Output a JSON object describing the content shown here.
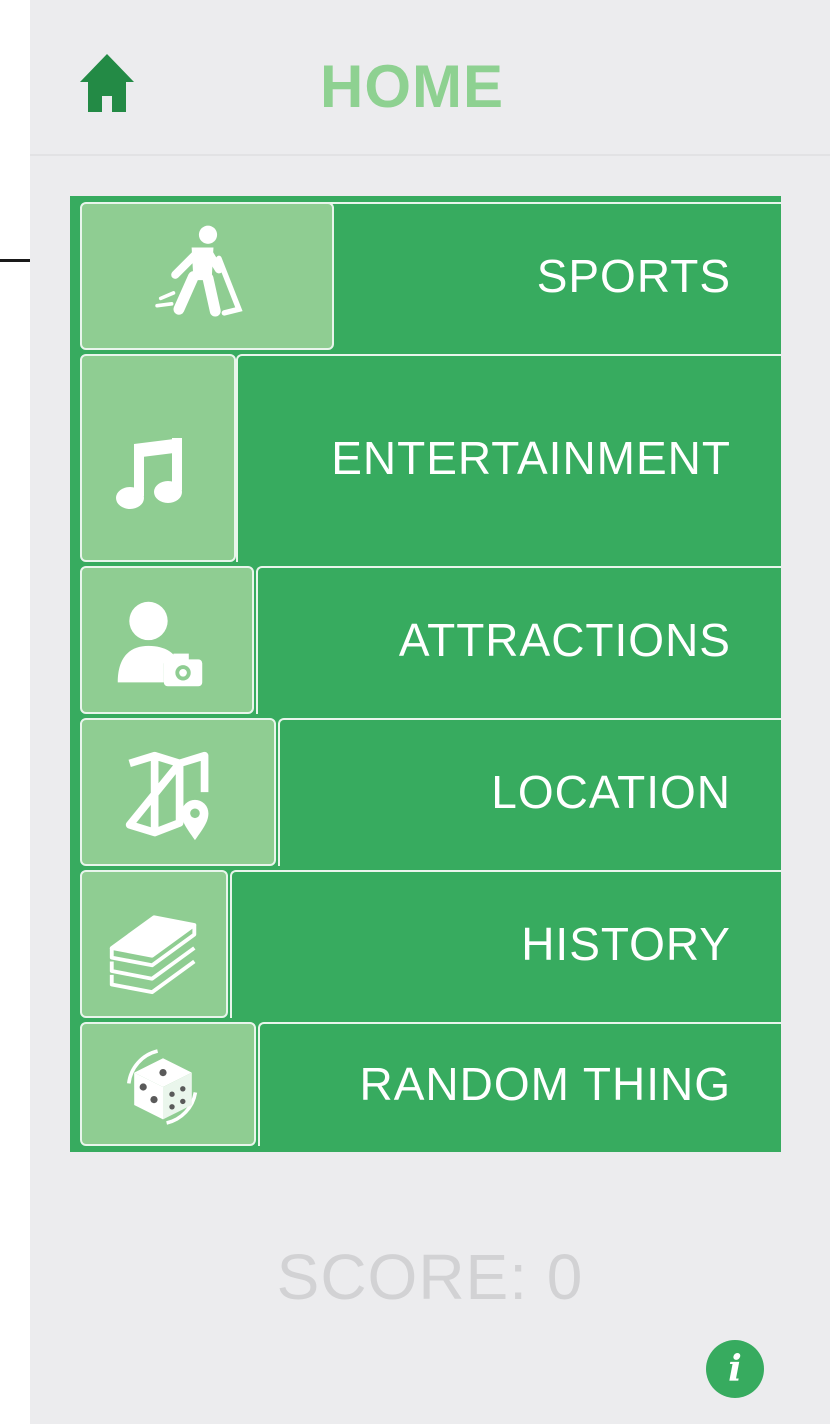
{
  "header": {
    "title": "HOME",
    "home_icon": "home-icon"
  },
  "menu": {
    "items": [
      {
        "label": "SPORTS",
        "icon": "hockey-player-icon"
      },
      {
        "label": "ENTERTAINMENT",
        "icon": "music-note-icon"
      },
      {
        "label": "ATTRACTIONS",
        "icon": "tourist-camera-icon"
      },
      {
        "label": "LOCATION",
        "icon": "map-pin-icon"
      },
      {
        "label": "HISTORY",
        "icon": "books-icon"
      },
      {
        "label": "RANDOM THING",
        "icon": "dice-icon"
      }
    ]
  },
  "score": {
    "text": "SCORE: 0"
  },
  "info": {
    "glyph": "i",
    "icon": "info-icon"
  },
  "colors": {
    "primary": "#37ab5f",
    "tile": "#8fcd92",
    "title": "#8ed191",
    "background": "#ececee"
  }
}
